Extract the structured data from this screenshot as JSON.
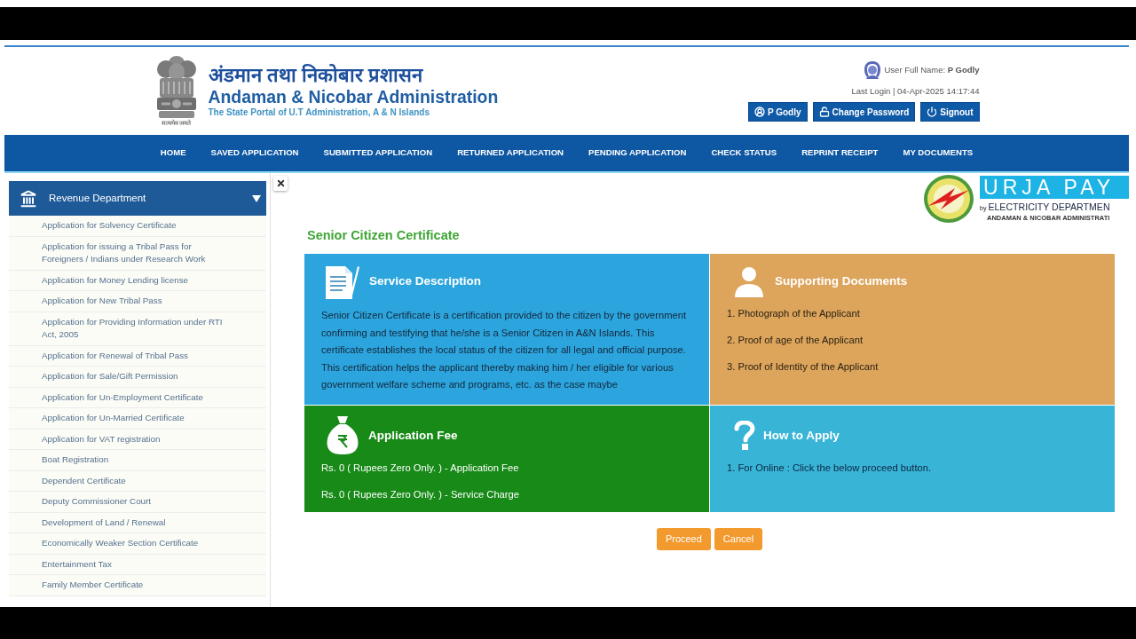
{
  "header": {
    "emblem_caption": "सत्यमेव जयते",
    "title_hindi": "अंडमान तथा निकोबार प्रशासन",
    "title": "Andaman & Nicobar Administration",
    "tagline": "The State Portal of U.T Administration, A & N Islands"
  },
  "user": {
    "label": "User Full Name: **P Godly**",
    "last_login": "Last Login | 04-Apr-2025 14:17:44",
    "buttons": [
      {
        "kind": "profile",
        "label": "P Godly"
      },
      {
        "kind": "password",
        "label": "Change Password"
      },
      {
        "kind": "signout",
        "label": "Signout"
      }
    ]
  },
  "nav": [
    "HOME",
    "SAVED APPLICATION",
    "SUBMITTED APPLICATION",
    "RETURNED APPLICATION",
    "PENDING APPLICATION",
    "CHECK STATUS",
    "REPRINT RECEIPT",
    "MY DOCUMENTS"
  ],
  "sidebar": {
    "title": "Revenue Department",
    "expanded": true,
    "items": [
      "Application for Solvency Certificate",
      "Application for issuing a Tribal Pass for Foreigners / Indians under Research Work",
      "Application for Money Lending license",
      "Application for New Tribal Pass",
      "Application for Providing Information under RTI Act, 2005",
      "Application for Renewal of Tribal Pass",
      "Application for Sale/Gift Permission",
      "Application for Un-Employment Certificate",
      "Application for Un-Married Certificate",
      "Application for VAT registration",
      "Boat Registration",
      "Dependent Certificate",
      "Deputy Commissioner Court",
      "Development of Land / Renewal",
      "Economically Weaker Section Certificate",
      "Entertainment Tax",
      "Family Member Certificate"
    ]
  },
  "banner": {
    "name": "URJA PAY",
    "by": "by",
    "department": "ELECTRICITY DEPARTMEN",
    "administration": "ANDAMAN & NICOBAR ADMINISTRATI"
  },
  "page_title": "Senior Citizen Certificate",
  "cards": [
    {
      "kind": "description",
      "color": "#2ca5de",
      "title": "Service Description",
      "text": "Senior Citizen Certificate is a certification provided to the citizen by the government confirming and testifying that he/she is a Senior Citizen in A&N Islands. This certificate establishes the local status of the citizen for all legal and official purpose. This certification helps the applicant thereby making him / her eligible for various government welfare scheme and programs, etc. as the case maybe"
    },
    {
      "kind": "documents",
      "color": "#dda45c",
      "title": "Supporting Documents",
      "items": [
        "1. Photograph of the Applicant",
        "2. Proof of age of the Applicant",
        "3. Proof of Identity of the Applicant"
      ]
    },
    {
      "kind": "fee",
      "color": "#188a18",
      "title": "Application Fee",
      "items": [
        "Rs. 0 ( Rupees Zero Only. ) - Application Fee",
        "Rs. 0 ( Rupees Zero Only. ) - Service Charge"
      ]
    },
    {
      "kind": "how_to_apply",
      "color": "#38b4d7",
      "title": "How to Apply",
      "items": [
        "1. For Online : Click the below proceed button."
      ]
    }
  ],
  "actions": [
    "Proceed",
    "Cancel"
  ]
}
